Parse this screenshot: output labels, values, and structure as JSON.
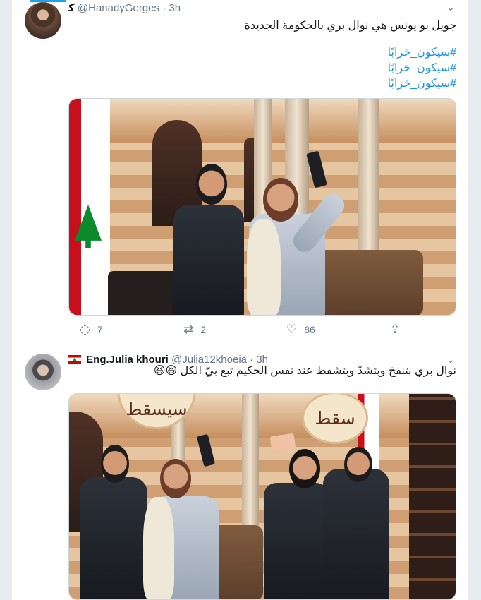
{
  "accent": "#1da1f2",
  "link_color": "#1b95e0",
  "tweets": [
    {
      "display_name": "ﮐ",
      "handle": "@HanadyGerges",
      "separator": "·",
      "time": "3h",
      "text": "جويل بو يونس هي نوال بري بالحكومة الجديدة",
      "hashtags": [
        "#سيكون_خرابًا",
        "#سيكون_خرابًا",
        "#سيكون_خرابًا"
      ],
      "counts": {
        "replies": "7",
        "retweets": "2",
        "likes": "86"
      }
    },
    {
      "flag": "Lebanon flag",
      "display_name": "Eng.Julia khouri",
      "handle": "@Julia12khoeia",
      "separator": "·",
      "time": "3h",
      "text": "نوال بري بتنفخ وبتشدّ وبتشفط عند نفس الحكيم تبع بيّ الكل 😆😆",
      "image_labels": {
        "left": "سيسقط",
        "right": "سقط"
      }
    }
  ]
}
